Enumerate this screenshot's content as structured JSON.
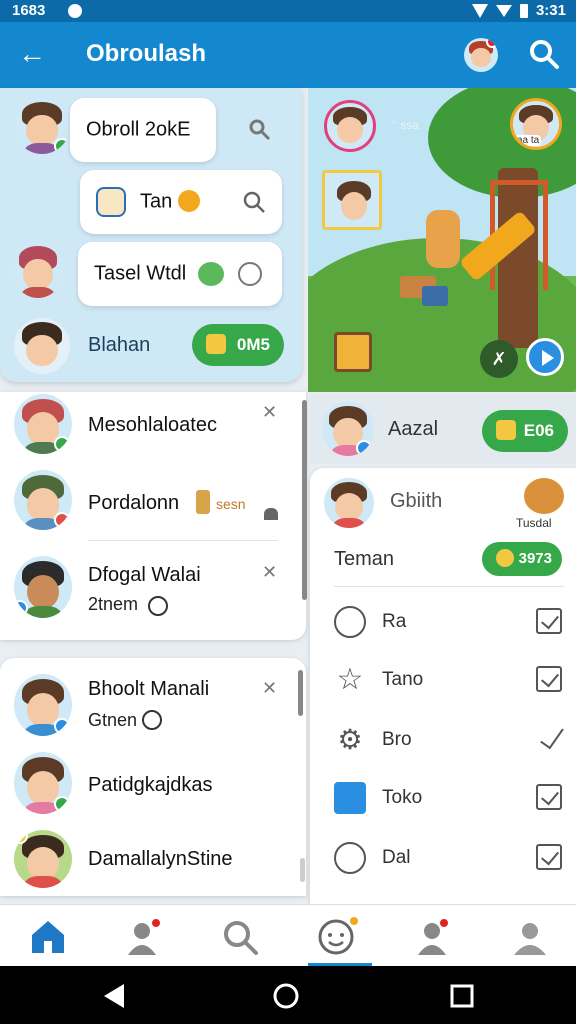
{
  "status": {
    "time": "1683",
    "right_time": "3:31"
  },
  "appbar": {
    "title": "Obroulash"
  },
  "left_panel": {
    "bubble1": "Obroll 2okE",
    "bubble2": "Tan",
    "bubble3": "Tasel Wtdl",
    "user_name": "Blahan",
    "chip_label": "0M5"
  },
  "game": {
    "sky_text": "‘’ ssa",
    "tag": "aa ta"
  },
  "list_card1": [
    {
      "name": "Mesohlaloatec",
      "sub": ""
    },
    {
      "name": "Pordalonn",
      "sub": "sesn"
    },
    {
      "name": "Dfogal Walai",
      "sub": "2tnem"
    }
  ],
  "list_card2": [
    {
      "name": "Bhoolt Manali",
      "sub": "Gtnen"
    },
    {
      "name": "Patidgkajdkas",
      "sub": ""
    },
    {
      "name": "DamallalynStine",
      "sub": ""
    }
  ],
  "contact": {
    "name": "Aazal",
    "chip": "E06"
  },
  "panel": {
    "header_name": "Gbiith",
    "bear_label": "Tusdal",
    "teman_label": "Teman",
    "teman_chip": "3973",
    "options": [
      {
        "label": "Ra",
        "icon": "smile-icon",
        "state": "checked"
      },
      {
        "label": "Tano",
        "icon": "star-icon",
        "state": "checked"
      },
      {
        "label": "Bro",
        "icon": "gear-icon",
        "state": "tick"
      },
      {
        "label": "Toko",
        "icon": "building-icon",
        "state": "checked"
      },
      {
        "label": "Dal",
        "icon": "face-icon",
        "state": "checked"
      }
    ]
  },
  "colors": {
    "primary": "#1488cf",
    "accent_green": "#37a84a",
    "badge_red": "#e02424"
  }
}
